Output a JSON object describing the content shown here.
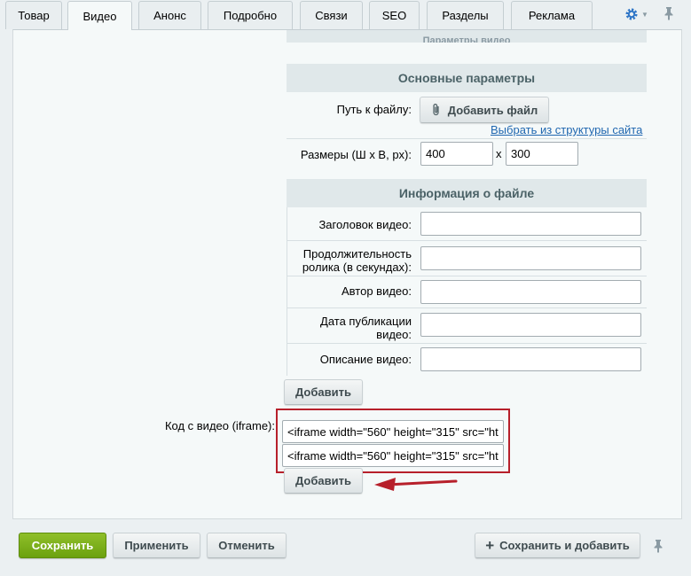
{
  "tabs": [
    {
      "label": "Товар",
      "active": false
    },
    {
      "label": "Видео",
      "active": true
    },
    {
      "label": "Анонс",
      "active": false
    },
    {
      "label": "Подробно",
      "active": false
    },
    {
      "label": "Связи",
      "active": false
    },
    {
      "label": "SEO",
      "active": false
    },
    {
      "label": "Разделы",
      "active": false
    },
    {
      "label": "Реклама",
      "active": false
    }
  ],
  "toolbar": {
    "settings_icon": "gear-icon",
    "pin_icon": "pin-icon"
  },
  "video_form": {
    "top_section_partial": "Параметры видео",
    "main_params_header": "Основные параметры",
    "file_path_label": "Путь к файлу:",
    "add_file_label": "Добавить файл",
    "add_file_icon": "paperclip-icon",
    "choose_structure_link": "Выбрать из структуры сайта",
    "size_label": "Размеры (Ш х В, px):",
    "width_value": "400",
    "size_separator": "x",
    "height_value": "300",
    "file_info_header": "Информация о файле",
    "video_title_label": "Заголовок видео:",
    "video_title_value": "",
    "duration_label_line1": "Продолжительность",
    "duration_label_line2": "ролика (в секундах):",
    "duration_value": "",
    "author_label": "Автор видео:",
    "author_value": "",
    "pub_date_label_line1": "Дата публикации",
    "pub_date_label_line2": "видео:",
    "pub_date_value": "",
    "description_label": "Описание видео:",
    "description_value": "",
    "add_button": "Добавить"
  },
  "iframe_field": {
    "label": "Код с видео (iframe):",
    "values": [
      "<iframe width=\"560\" height=\"315\" src=\"ht",
      "<iframe width=\"560\" height=\"315\" src=\"ht"
    ],
    "add_button": "Добавить",
    "highlight_color": "#b7202b"
  },
  "footer": {
    "save": "Сохранить",
    "apply": "Применить",
    "cancel": "Отменить",
    "save_and_add": "Сохранить и добавить",
    "save_and_add_icon": "plus-icon"
  },
  "colors": {
    "accent_green": "#6ba10f",
    "link_blue": "#2067b0"
  }
}
